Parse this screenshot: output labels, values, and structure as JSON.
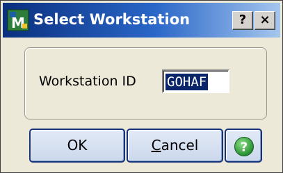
{
  "window": {
    "title": "Select Workstation",
    "app_icon": "sage-mas-icon"
  },
  "titlebar_buttons": {
    "help": "?",
    "close": "×"
  },
  "form": {
    "workstation_label": "Workstation ID",
    "workstation_value": "GOHAF"
  },
  "buttons": {
    "ok": "OK",
    "cancel_first": "C",
    "cancel_rest": "ancel",
    "help_icon": "help-question-icon"
  },
  "colors": {
    "selection": "#0a246a",
    "help_green": "#2e9b3a",
    "button_border": "#15327a"
  }
}
